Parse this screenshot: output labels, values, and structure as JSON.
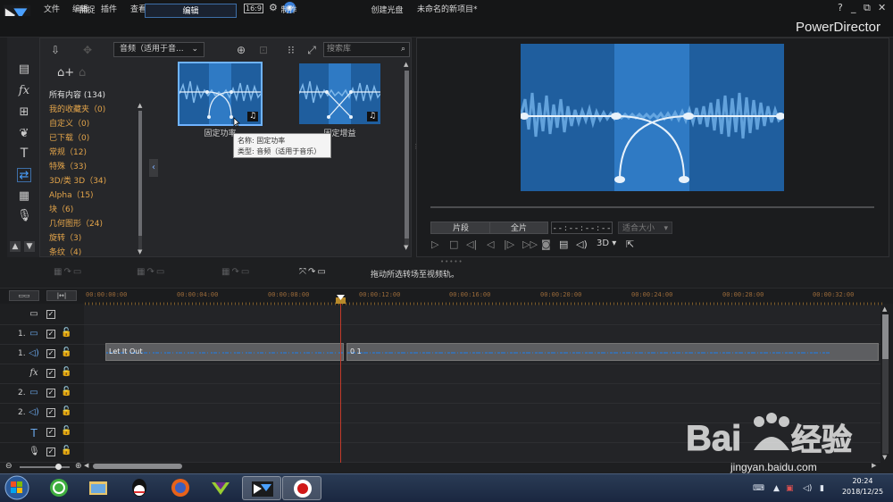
{
  "titlebar": {
    "menus": [
      "文件",
      "编辑",
      "插件",
      "查看",
      "播放"
    ],
    "document_title": "未命名的新项目*",
    "help": "?"
  },
  "modes": {
    "tabs": [
      "捕捉",
      "编辑",
      "制作",
      "创建光盘"
    ],
    "active": "编辑"
  },
  "brand": "PowerDirector",
  "library": {
    "type_select": "音频（适用于音...",
    "search_placeholder": "搜索库",
    "categories": [
      {
        "label": "所有内容 (134)"
      },
      {
        "label": "我的收藏夹（0)"
      },
      {
        "label": "自定义（0)"
      },
      {
        "label": "已下载（0)"
      },
      {
        "label": "常规（12)"
      },
      {
        "label": "特殊（33)"
      },
      {
        "label": "3D/类 3D（34)"
      },
      {
        "label": "Alpha（15)"
      },
      {
        "label": "块（6)"
      },
      {
        "label": "几何图形（24)"
      },
      {
        "label": "旋转（3)"
      },
      {
        "label": "条纹（4)"
      }
    ],
    "items": [
      {
        "label": "固定功率",
        "selected": true
      },
      {
        "label": "固定增益",
        "selected": false
      }
    ],
    "tooltip": {
      "line1": "名称: 固定功率",
      "line2": "类型: 音频（适用于音乐）"
    }
  },
  "preview": {
    "tab_clip": "片段",
    "tab_movie": "全片",
    "timecode": "- - : - - : - - : - -",
    "fit": "适合大小",
    "mode_3d": "3D"
  },
  "timeline_toolbar": {
    "hint": "拖动所选转场至视频轨。"
  },
  "timeline": {
    "ruler": [
      "00:00:00:00",
      "00:00:04:00",
      "00:00:08:00",
      "00:00:12:00",
      "00:00:16:00",
      "00:00:20:00",
      "00:00:24:00",
      "00:00:28:00",
      "00:00:32:00"
    ],
    "tracks": [
      {
        "num": "",
        "icon": "chapter",
        "glyph": "▭"
      },
      {
        "num": "1.",
        "icon": "video",
        "glyph": "▭"
      },
      {
        "num": "1.",
        "icon": "audio",
        "glyph": "◁)"
      },
      {
        "num": "",
        "icon": "fx",
        "glyph": "fx"
      },
      {
        "num": "2.",
        "icon": "video",
        "glyph": "▭"
      },
      {
        "num": "2.",
        "icon": "audio",
        "glyph": "◁)"
      },
      {
        "num": "",
        "icon": "title",
        "glyph": "T"
      },
      {
        "num": "",
        "icon": "voice",
        "glyph": "🎙"
      }
    ],
    "clips": [
      {
        "label": "Let It Out"
      },
      {
        "label": "0 1"
      }
    ]
  },
  "taskbar": {
    "time": "20:24",
    "date": "2018/12/25"
  },
  "watermark": {
    "text": "jingyan.baidu.com",
    "logo_text": "Baidu 经验"
  }
}
